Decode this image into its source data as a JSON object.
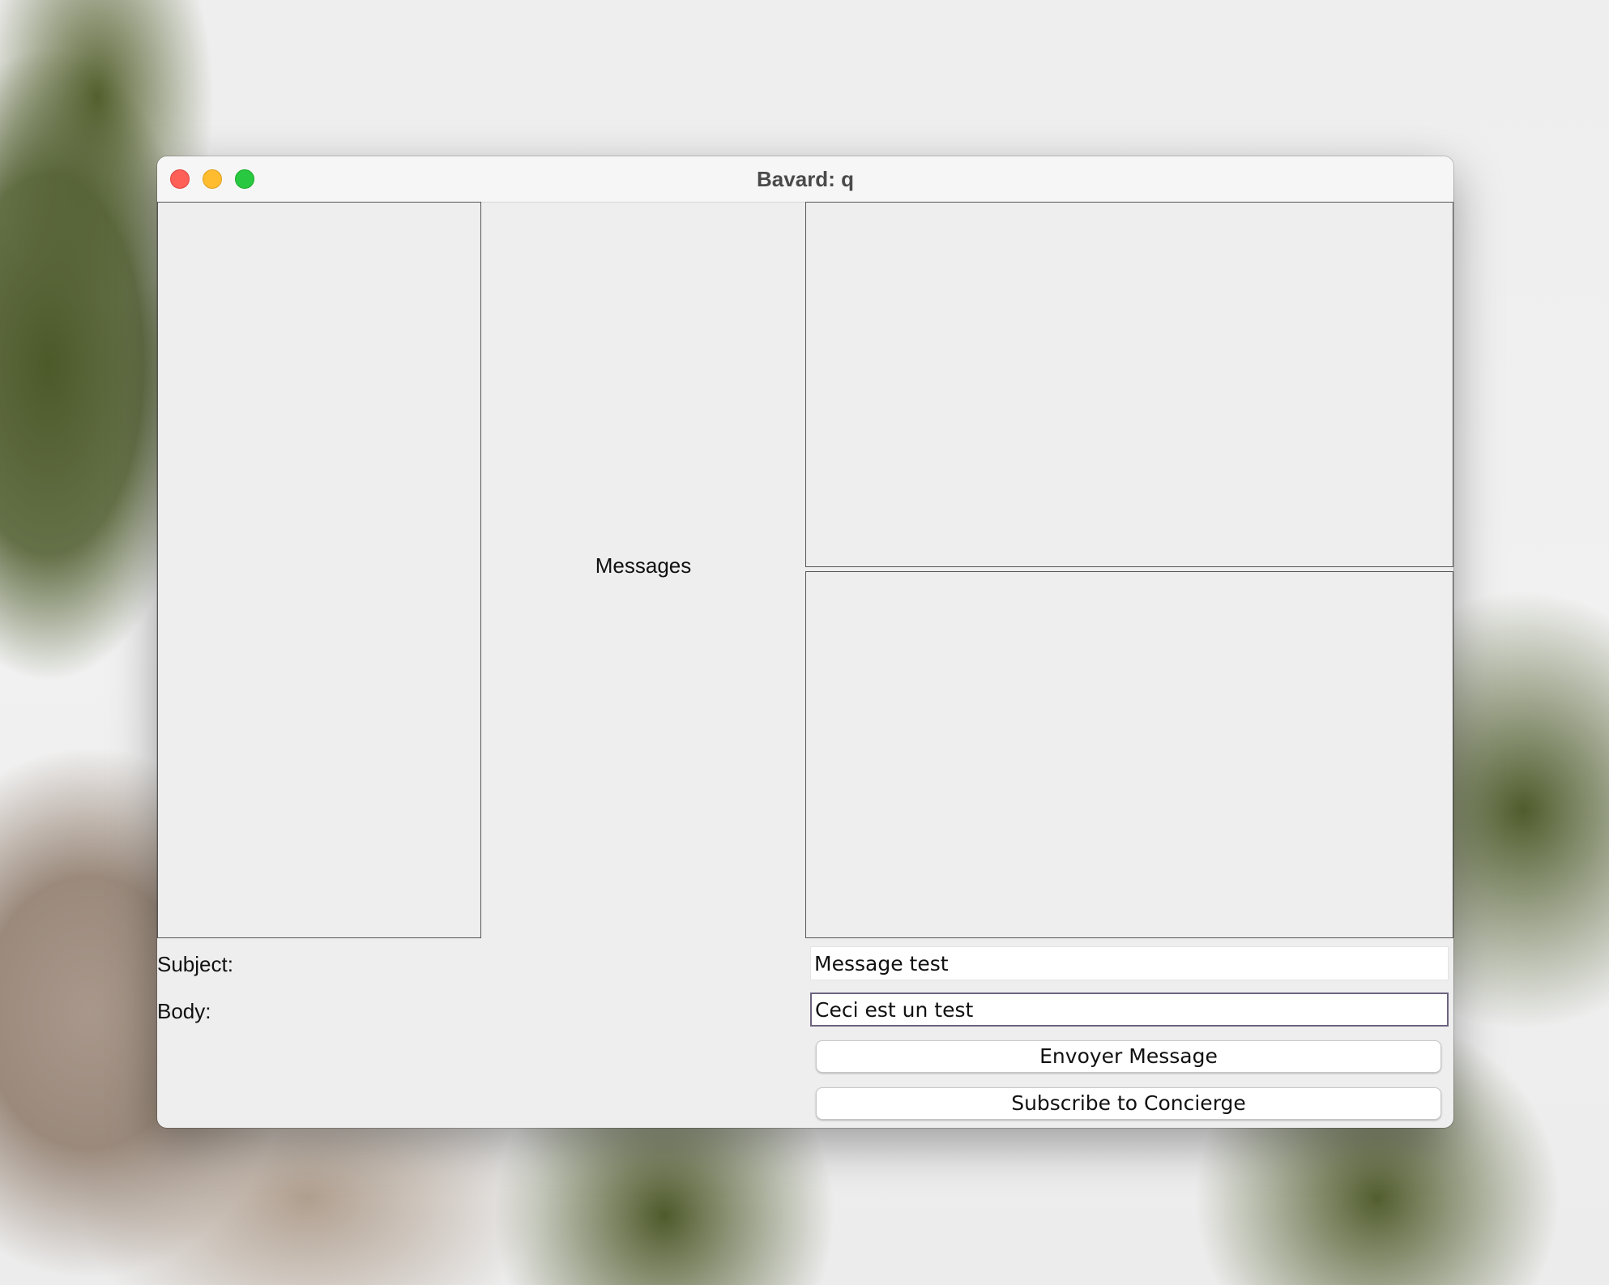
{
  "window": {
    "title": "Bavard: q"
  },
  "main": {
    "messages_label": "Messages"
  },
  "form": {
    "subject_label": "Subject:",
    "subject_value": "Message test",
    "body_label": "Body:",
    "body_value": "Ceci est un test",
    "send_label": "Envoyer Message",
    "subscribe_label": "Subscribe to Concierge"
  },
  "icons": {
    "close": "close-icon",
    "minimize": "minimize-icon",
    "maximize": "maximize-icon"
  },
  "colors": {
    "close": "#fe5f57",
    "minimize": "#febc2e",
    "maximize": "#28c840",
    "window_bg": "#eeeeee"
  }
}
